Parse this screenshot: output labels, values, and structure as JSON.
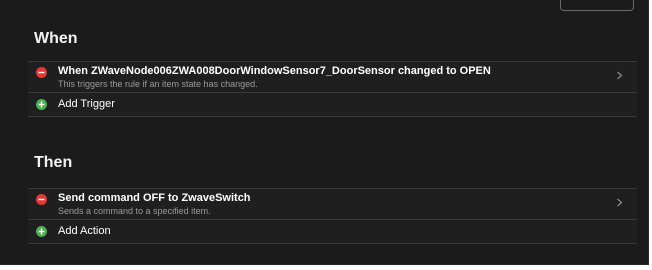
{
  "colors": {
    "background": "#1b1b1b",
    "row_background": "#1f1f1f",
    "remove_icon": "#e53935",
    "add_icon": "#4caf50",
    "text_primary": "#ffffff",
    "text_secondary": "#9a9a9a"
  },
  "when": {
    "heading": "When",
    "trigger": {
      "title": "When ZWaveNode006ZWA008DoorWindowSensor7_DoorSensor changed to OPEN",
      "description": "This triggers the rule if an item state has changed.",
      "leading_icon": "remove-icon",
      "trailing_icon": "chevron-right-icon"
    },
    "add_label": "Add Trigger",
    "add_icon": "add-icon"
  },
  "then": {
    "heading": "Then",
    "action": {
      "title": "Send command OFF to ZwaveSwitch",
      "description": "Sends a command to a specified item.",
      "leading_icon": "remove-icon",
      "trailing_icon": "chevron-right-icon"
    },
    "add_label": "Add Action",
    "add_icon": "add-icon"
  }
}
